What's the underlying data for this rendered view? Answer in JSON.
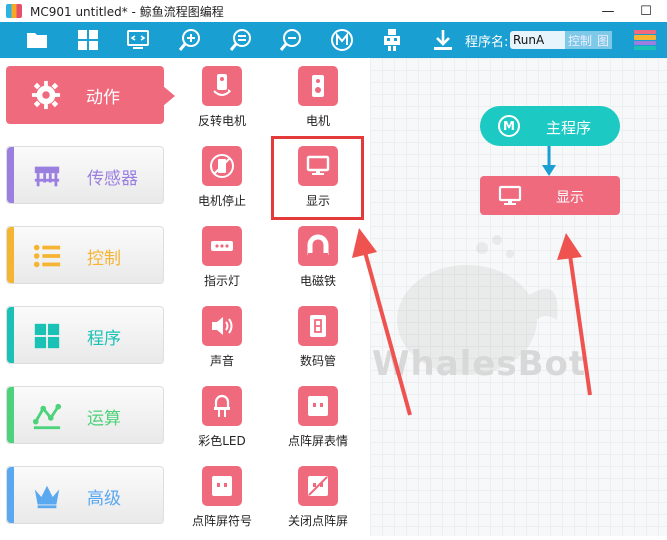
{
  "window": {
    "title": "MC901 untitled* - 鲸鱼流程图编程",
    "minimize": "—",
    "maximize": "☐"
  },
  "toolbar": {
    "program_name_label": "程序名:",
    "program_name_value": "RunA",
    "tag1": "控制",
    "tag2": "图",
    "icons": [
      "folder-icon",
      "grid-icon",
      "code-monitor-icon",
      "zoom-in-icon",
      "zoom-reset-icon",
      "zoom-out-icon",
      "m-circle-icon",
      "robot-icon",
      "download-icon"
    ]
  },
  "categories": [
    {
      "label": "动作",
      "color": "#f06a7e",
      "active": true
    },
    {
      "label": "传感器",
      "color": "#9b7fe0"
    },
    {
      "label": "控制",
      "color": "#f5b431"
    },
    {
      "label": "程序",
      "color": "#19c2b5"
    },
    {
      "label": "运算",
      "color": "#4cd27a"
    },
    {
      "label": "高级",
      "color": "#5aa8f0"
    }
  ],
  "blocks": [
    {
      "label": "反转电机"
    },
    {
      "label": "电机"
    },
    {
      "label": "电机停止"
    },
    {
      "label": "显示"
    },
    {
      "label": "指示灯"
    },
    {
      "label": "电磁铁"
    },
    {
      "label": "声音"
    },
    {
      "label": "数码管"
    },
    {
      "label": "彩色LED"
    },
    {
      "label": "点阵屏表情"
    },
    {
      "label": "点阵屏符号"
    },
    {
      "label": "关闭点阵屏"
    }
  ],
  "flow": {
    "main_node": {
      "label": "主程序",
      "badge": "M"
    },
    "show_node": {
      "label": "显示"
    }
  },
  "watermark": "WhalesBot",
  "colors": {
    "toolbar": "#1a9fd3",
    "accent": "#f06a7e",
    "teal": "#1cc9c3",
    "annotation": "#e53a3a"
  }
}
